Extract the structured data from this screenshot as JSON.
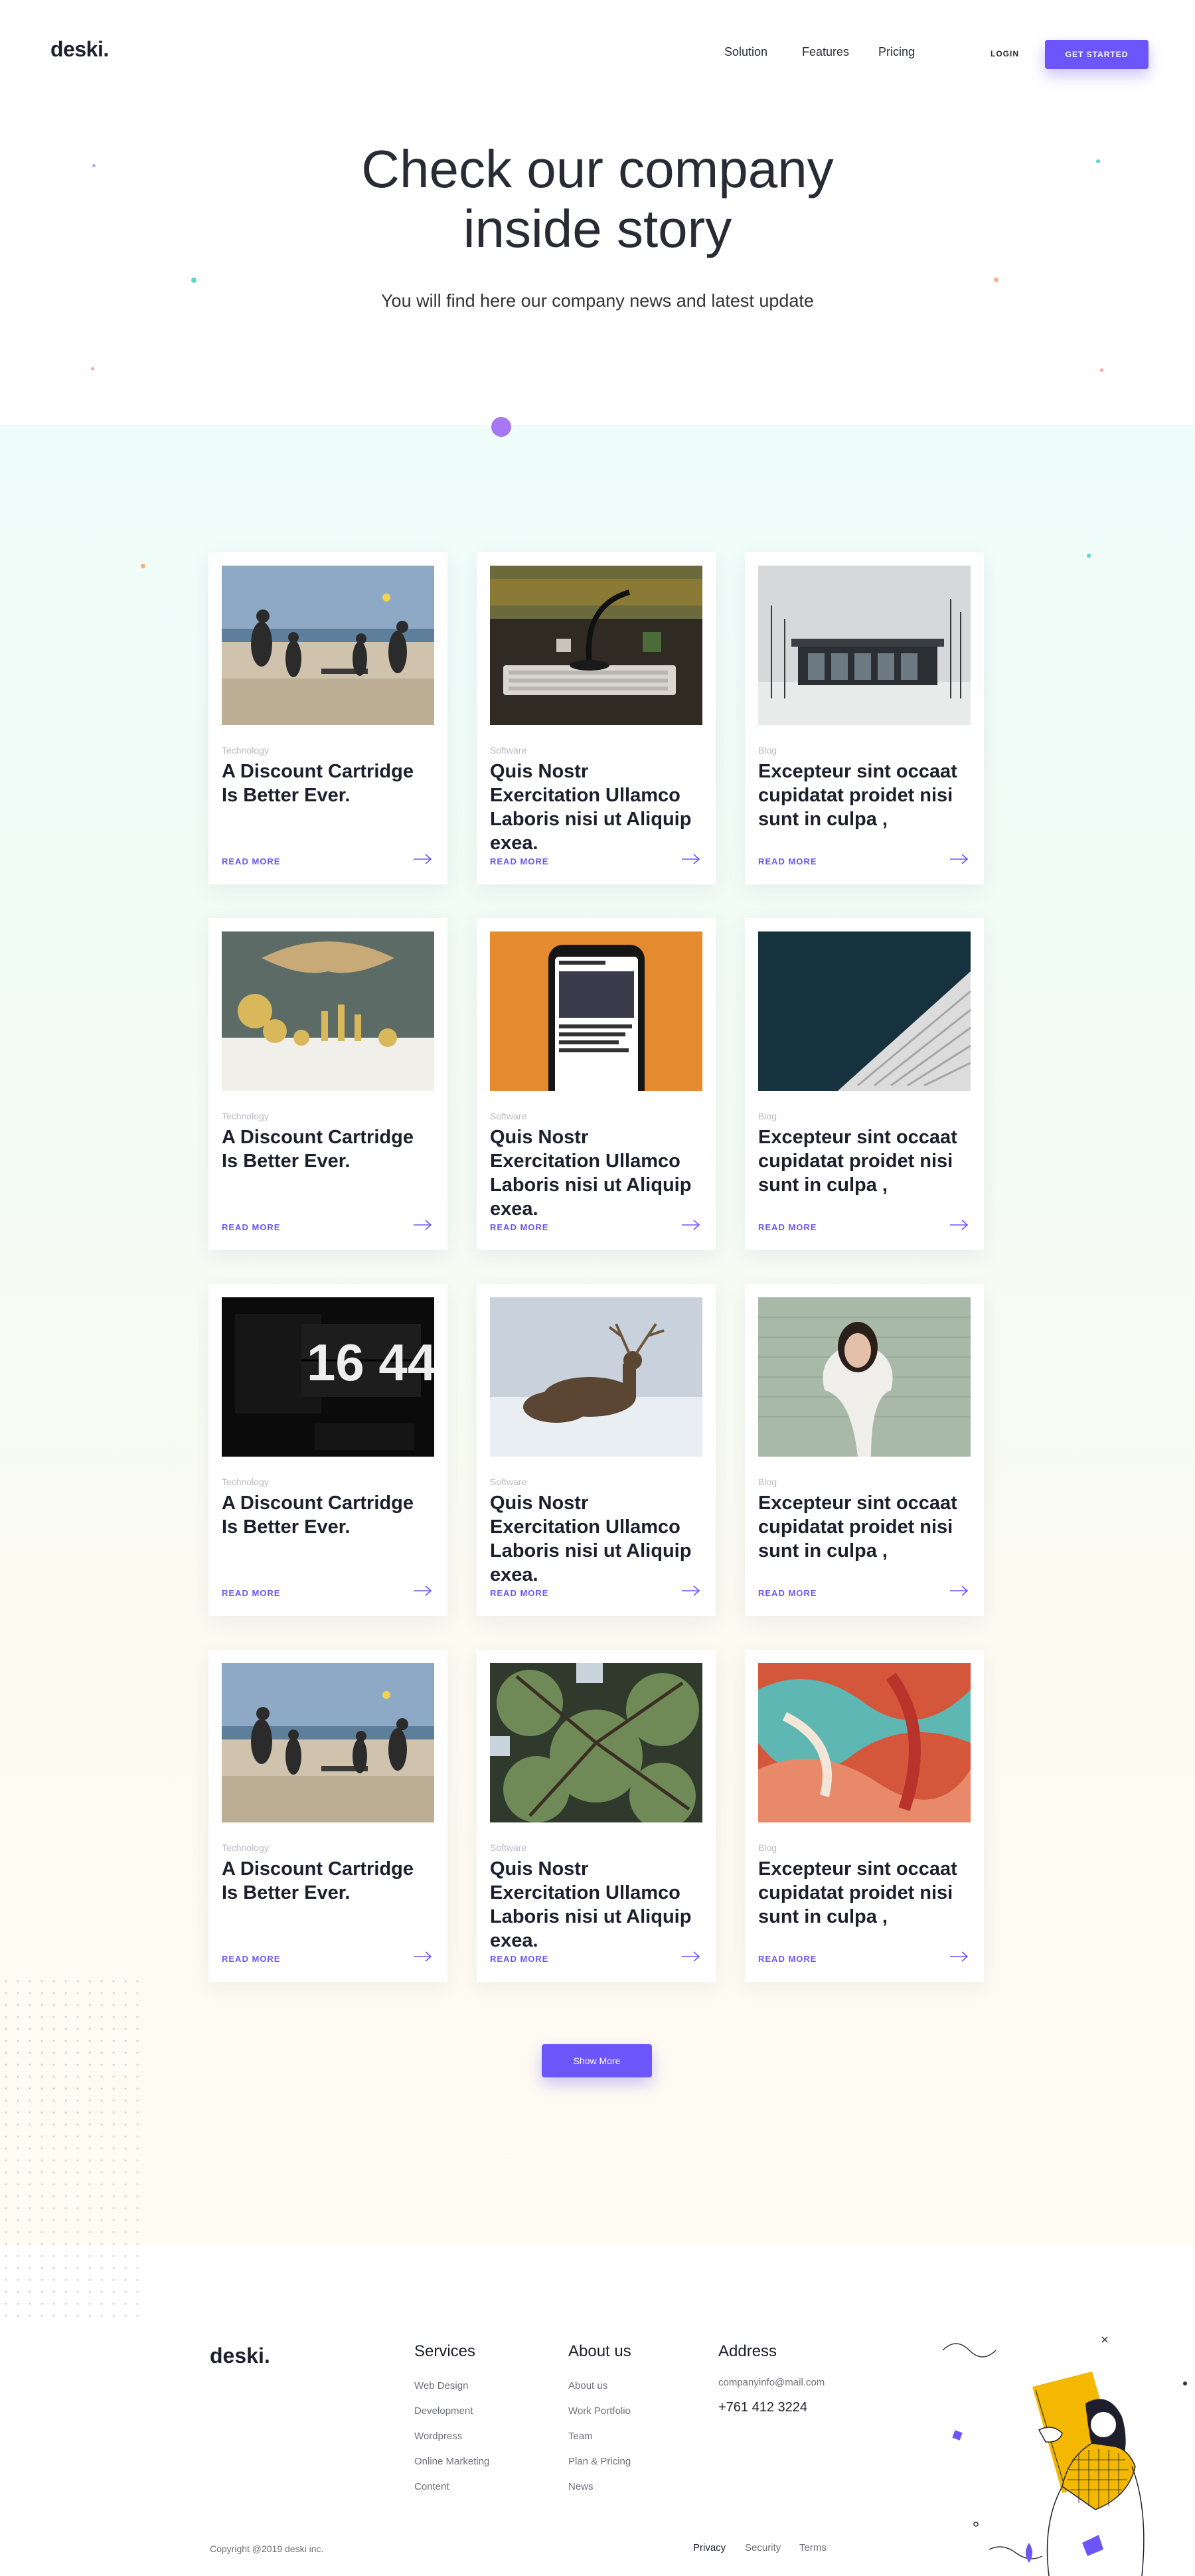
{
  "brand": {
    "logo": "deski."
  },
  "nav": {
    "items": [
      "Solution",
      "Features",
      "Pricing"
    ],
    "login": "LOGIN",
    "cta": "GET STARTED"
  },
  "hero": {
    "title_line1": "Check our company",
    "title_line2": "inside story",
    "subtitle": "You will find here our company news and latest update"
  },
  "posts": [
    {
      "category": "Technology",
      "title": "A Discount Cartridge Is Better Ever.",
      "read_more": "READ MORE",
      "image": "beach-volleyball"
    },
    {
      "category": "Software",
      "title": "Quis Nostr Exercitation Ullamco Laboris nisi ut Aliquip exea.",
      "read_more": "READ MORE",
      "image": "desk-keyboard"
    },
    {
      "category": "Blog",
      "title": "Excepteur sint occaat cupidatat proidet nisi sunt in culpa ,",
      "read_more": "READ MORE",
      "image": "modern-building"
    },
    {
      "category": "Technology",
      "title": "A Discount Cartridge Is Better Ever.",
      "read_more": "READ MORE",
      "image": "gold-decor"
    },
    {
      "category": "Software",
      "title": "Quis Nostr Exercitation Ullamco Laboris nisi ut Aliquip exea.",
      "read_more": "READ MORE",
      "image": "phone-news"
    },
    {
      "category": "Blog",
      "title": "Excepteur sint occaat cupidatat proidet nisi sunt in culpa ,",
      "read_more": "READ MORE",
      "image": "tower-sky"
    },
    {
      "category": "Technology",
      "title": "A Discount Cartridge Is Better Ever.",
      "read_more": "READ MORE",
      "image": "flip-clock",
      "image_text": "16 44"
    },
    {
      "category": "Software",
      "title": "Quis Nostr Exercitation Ullamco Laboris nisi ut Aliquip exea.",
      "read_more": "READ MORE",
      "image": "deer-snow"
    },
    {
      "category": "Blog",
      "title": "Excepteur sint occaat cupidatat proidet nisi sunt in culpa ,",
      "read_more": "READ MORE",
      "image": "smiling-woman"
    },
    {
      "category": "Technology",
      "title": "A Discount Cartridge Is Better Ever.",
      "read_more": "READ MORE",
      "image": "beach-volleyball"
    },
    {
      "category": "Software",
      "title": "Quis Nostr Exercitation Ullamco Laboris nisi ut Aliquip exea.",
      "read_more": "READ MORE",
      "image": "pine-tree"
    },
    {
      "category": "Blog",
      "title": "Excepteur sint occaat cupidatat proidet nisi sunt in culpa ,",
      "read_more": "READ MORE",
      "image": "abstract-paint"
    }
  ],
  "show_more": "Show More",
  "footer": {
    "logo": "deski.",
    "services": {
      "heading": "Services",
      "links": [
        "Web Design",
        "Development",
        "Wordpress",
        "Online Marketing",
        "Content"
      ]
    },
    "about": {
      "heading": "About us",
      "links": [
        "About us",
        "Work Portfolio",
        "Team",
        "Plan & Pricing",
        "News"
      ]
    },
    "address": {
      "heading": "Address",
      "email": "companyinfo@mail.com",
      "phone": "+761 412 3224"
    },
    "copyright": "Copyright @2019 deski inc.",
    "bottom_links": [
      "Privacy",
      "Security",
      "Terms"
    ]
  },
  "colors": {
    "accent": "#6c55f9",
    "text": "#1e1e2d",
    "muted": "#b9b9c2",
    "illustration_yellow": "#f5b800"
  }
}
